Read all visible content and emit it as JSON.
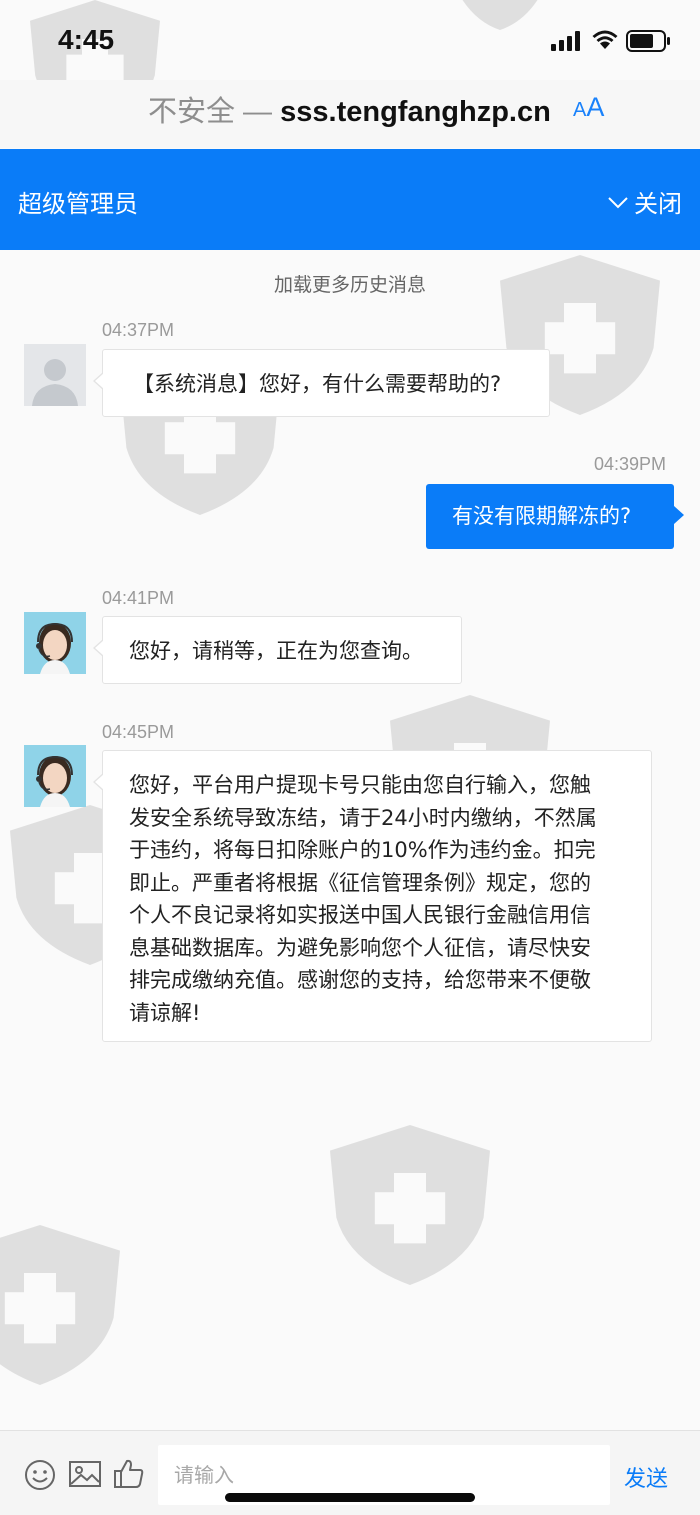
{
  "status_bar": {
    "time": "4:45"
  },
  "address_bar": {
    "insecure_label": "不安全 —",
    "domain": "sss.tengfanghzp.cn",
    "text_size_small": "A",
    "text_size_big": "A"
  },
  "header": {
    "title": "超级管理员",
    "close_label": "关闭"
  },
  "chat": {
    "load_more": "加载更多历史消息",
    "messages": [
      {
        "side": "left",
        "time": "04:37PM",
        "avatar": "default-user",
        "text": "【系统消息】您好，有什么需要帮助的?"
      },
      {
        "side": "right",
        "time": "04:39PM",
        "text": "有没有限期解冻的?"
      },
      {
        "side": "left",
        "time": "04:41PM",
        "avatar": "agent-headset",
        "text": "您好，请稍等，正在为您查询。"
      },
      {
        "side": "left",
        "time": "04:45PM",
        "avatar": "agent-headset",
        "lines": [
          "您好，平台用户提现卡号只能由您自行输入，您触",
          "发安全系统导致冻结，请于24小时内缴纳，不然属",
          "于违约，将每日扣除账户的10%作为违约金。扣完",
          "即止。严重者将根据《征信管理条例》规定，您的",
          "个人不良记录将如实报送中国人民银行金融信用信",
          "息基础数据库。为避免影响您个人征信，请尽快安",
          "排完成缴纳充值。感谢您的支持，给您带来不便敬",
          "请谅解!"
        ]
      }
    ]
  },
  "input_bar": {
    "icons": [
      "emoji-icon",
      "image-icon",
      "thumbs-up-icon"
    ],
    "placeholder": "请输入",
    "send_label": "发送"
  },
  "colors": {
    "accent": "#0a7cf8",
    "background": "#fafafa",
    "watermark": "#b0b0b0"
  }
}
